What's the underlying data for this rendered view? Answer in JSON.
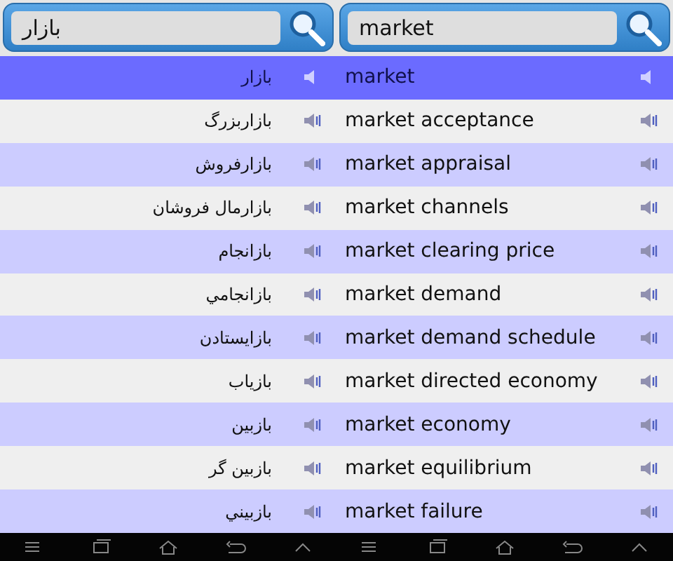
{
  "left_panel": {
    "kind": "rtl",
    "search": {
      "value": "بازار"
    },
    "rows": [
      {
        "word": "بازار",
        "selected": true
      },
      {
        "word": "بازاربزرگ",
        "selected": false
      },
      {
        "word": "بازارفروش",
        "selected": false
      },
      {
        "word": "بازارمال فروشان",
        "selected": false
      },
      {
        "word": "بازانجام",
        "selected": false
      },
      {
        "word": "بازانجامي",
        "selected": false
      },
      {
        "word": "بازايستادن",
        "selected": false
      },
      {
        "word": "بازياب",
        "selected": false
      },
      {
        "word": "بازبين",
        "selected": false
      },
      {
        "word": "بازبين گر",
        "selected": false
      },
      {
        "word": "بازبيني",
        "selected": false
      }
    ]
  },
  "right_panel": {
    "kind": "ltr",
    "search": {
      "value": "market"
    },
    "rows": [
      {
        "word": "market",
        "selected": true
      },
      {
        "word": "market acceptance",
        "selected": false
      },
      {
        "word": "market appraisal",
        "selected": false
      },
      {
        "word": "market channels",
        "selected": false
      },
      {
        "word": "market clearing price",
        "selected": false
      },
      {
        "word": "market demand",
        "selected": false
      },
      {
        "word": "market demand schedule",
        "selected": false
      },
      {
        "word": "market directed economy",
        "selected": false
      },
      {
        "word": "market economy",
        "selected": false
      },
      {
        "word": "market equilibrium",
        "selected": false
      },
      {
        "word": "market failure",
        "selected": false
      }
    ]
  }
}
